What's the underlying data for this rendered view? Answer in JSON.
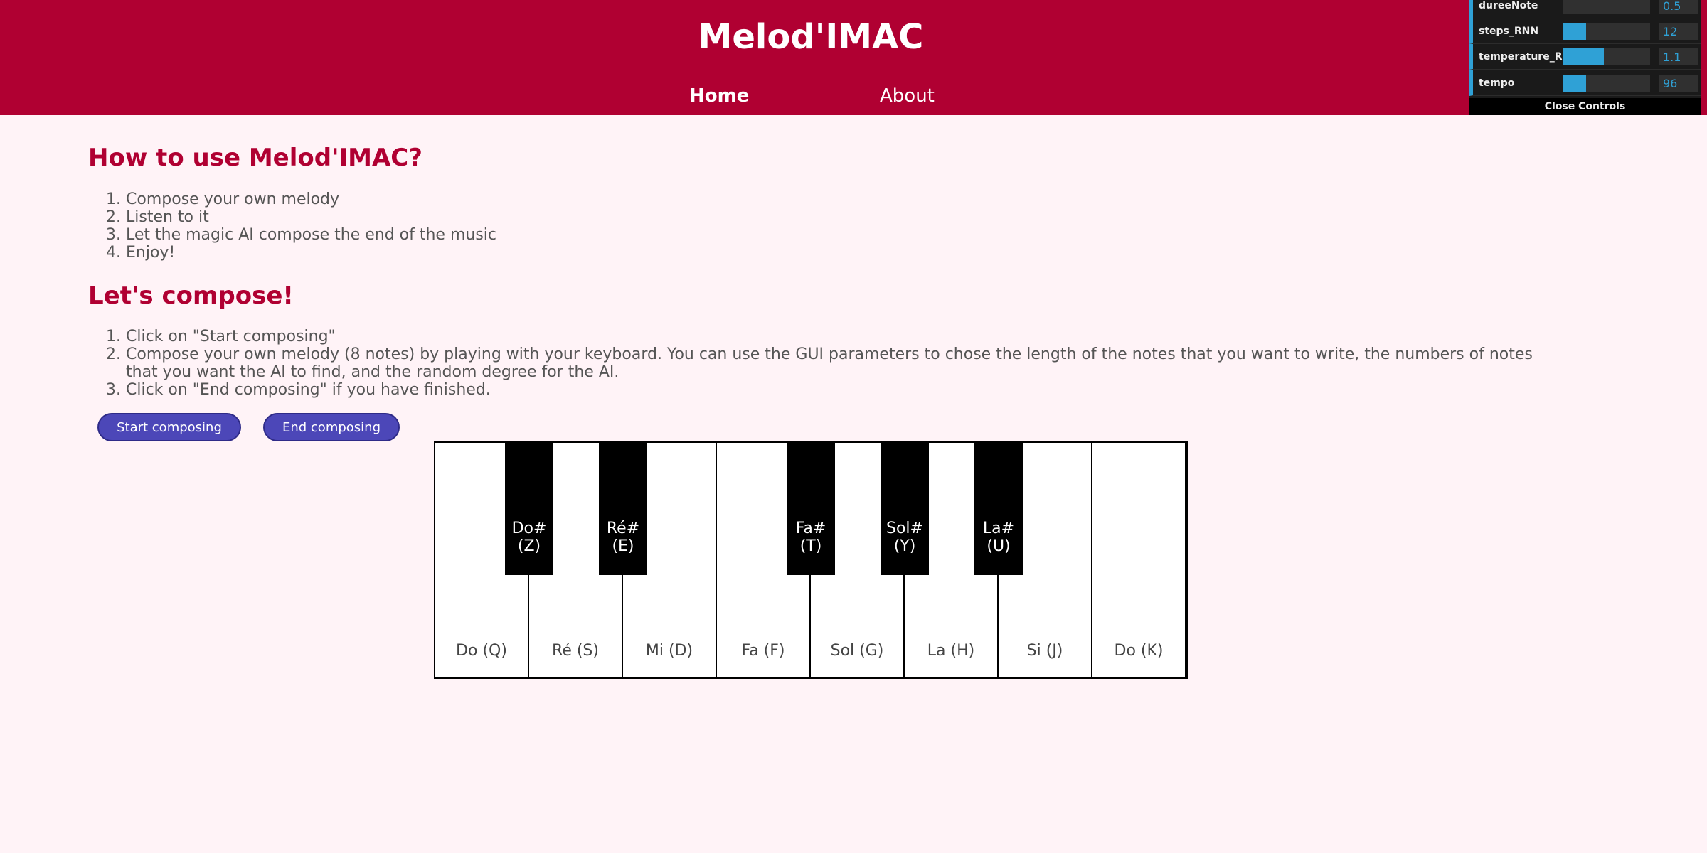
{
  "header": {
    "title": "Melod'IMAC",
    "nav": [
      {
        "label": "Home",
        "active": true
      },
      {
        "label": "About",
        "active": false
      }
    ],
    "background_color": "#b00032"
  },
  "gui": {
    "controls": [
      {
        "name": "dureeNote",
        "value": "0.5",
        "fraction": 0.0
      },
      {
        "name": "steps_RNN",
        "value": "12",
        "fraction": 0.26
      },
      {
        "name": "temperature_RNN",
        "value": "1.1",
        "fraction": 0.47
      },
      {
        "name": "tempo",
        "value": "96",
        "fraction": 0.26
      }
    ],
    "close_label": "Close Controls",
    "accent_color": "#2fa1d6"
  },
  "how_to": {
    "heading": "How to use Melod'IMAC?",
    "steps": [
      "Compose your own melody",
      "Listen to it",
      "Let the magic AI compose the end of the music",
      "Enjoy!"
    ]
  },
  "compose": {
    "heading": "Let's compose!",
    "steps": [
      "Click on \"Start composing\"",
      "Compose your own melody (8 notes) by playing with your keyboard. You can use the GUI parameters to chose the length of the notes that you want to write, the numbers of notes that you want the AI to find, and the random degree for the AI.",
      "Click on \"End composing\" if you have finished."
    ],
    "start_label": "Start composing",
    "end_label": "End composing",
    "button_color": "#4c47b8"
  },
  "piano": {
    "white_keys": [
      "Do (Q)",
      "Ré (S)",
      "Mi (D)",
      "Fa (F)",
      "Sol (G)",
      "La (H)",
      "Si (J)",
      "Do (K)"
    ],
    "black_keys": [
      {
        "note": "Do#",
        "key": "(Z)"
      },
      {
        "note": "Ré#",
        "key": "(E)"
      },
      {
        "note": "Fa#",
        "key": "(T)"
      },
      {
        "note": "Sol#",
        "key": "(Y)"
      },
      {
        "note": "La#",
        "key": "(U)"
      }
    ]
  }
}
